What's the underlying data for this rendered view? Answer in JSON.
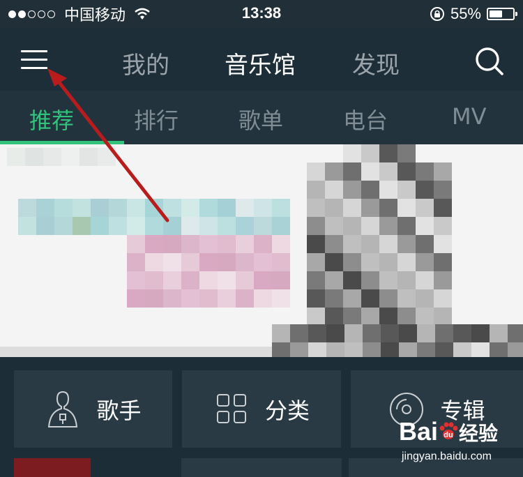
{
  "status_bar": {
    "carrier": "中国移动",
    "time": "13:38",
    "battery_percent": "55%",
    "battery_level": 0.55,
    "signal_bars_filled": 2,
    "signal_bars_total": 5,
    "icons": [
      "signal-dots-icon",
      "wifi-icon",
      "rotation-lock-icon",
      "battery-icon"
    ]
  },
  "top_nav": {
    "menu_icon": "hamburger-menu-icon",
    "tabs": [
      {
        "label": "我的",
        "active": false
      },
      {
        "label": "音乐馆",
        "active": true
      },
      {
        "label": "发现",
        "active": false
      }
    ],
    "search_icon": "search-icon"
  },
  "sub_tabs": [
    {
      "label": "推荐",
      "active": true
    },
    {
      "label": "排行",
      "active": false
    },
    {
      "label": "歌单",
      "active": false
    },
    {
      "label": "电台",
      "active": false
    },
    {
      "label": "MV",
      "active": false
    }
  ],
  "categories": [
    {
      "label": "歌手",
      "icon": "singer-icon"
    },
    {
      "label": "分类",
      "icon": "grid-icon"
    },
    {
      "label": "专辑",
      "icon": "album-disc-icon"
    }
  ],
  "watermark": {
    "logo": "Bai",
    "logo_suffix": "经验",
    "url": "jingyan.baidu.com"
  },
  "colors": {
    "accent": "#31c27c",
    "arrow": "#b91c1c",
    "background": "#1b2b35"
  }
}
